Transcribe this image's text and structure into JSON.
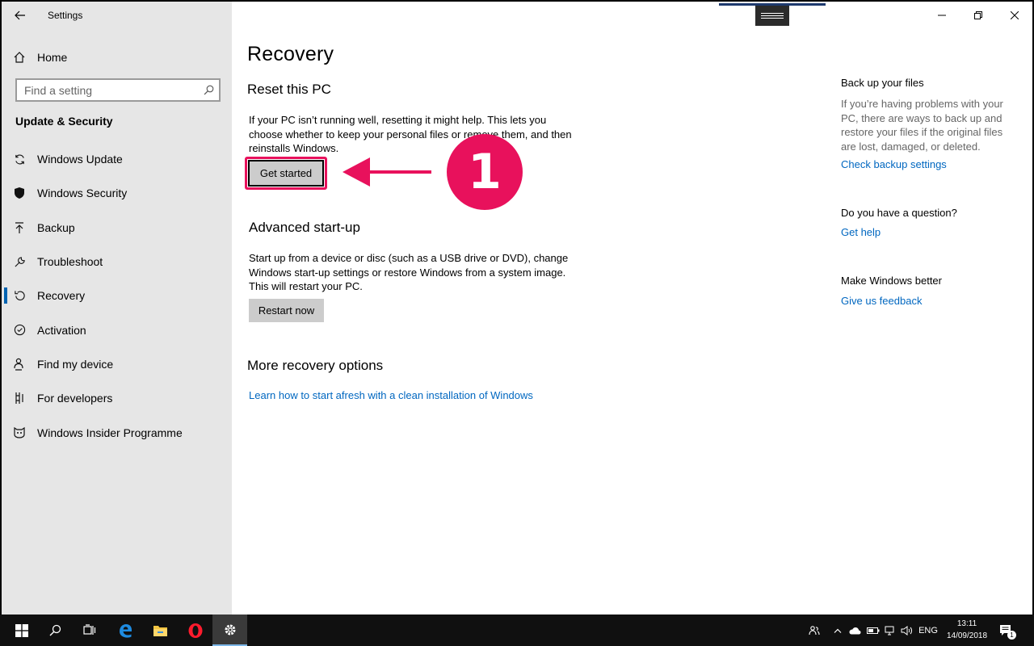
{
  "app": {
    "title": "Settings",
    "back_label": "←"
  },
  "sidebar": {
    "home_label": "Home",
    "search_placeholder": "Find a setting",
    "section_title": "Update & Security",
    "items": [
      {
        "label": "Windows Update",
        "icon": "sync-icon",
        "active": false
      },
      {
        "label": "Windows Security",
        "icon": "shield-icon",
        "active": false
      },
      {
        "label": "Backup",
        "icon": "backup-arrow-icon",
        "active": false
      },
      {
        "label": "Troubleshoot",
        "icon": "wrench-icon",
        "active": false
      },
      {
        "label": "Recovery",
        "icon": "recovery-icon",
        "active": true
      },
      {
        "label": "Activation",
        "icon": "check-circle-icon",
        "active": false
      },
      {
        "label": "Find my device",
        "icon": "person-location-icon",
        "active": false
      },
      {
        "label": "For developers",
        "icon": "developer-icon",
        "active": false
      },
      {
        "label": "Windows Insider Programme",
        "icon": "insider-icon",
        "active": false
      }
    ]
  },
  "main": {
    "page_title": "Recovery",
    "reset": {
      "heading": "Reset this PC",
      "description": "If your PC isn’t running well, resetting it might help. This lets you choose whether to keep your personal files or remove them, and then reinstalls Windows.",
      "button_label": "Get started"
    },
    "annotation": {
      "badge_number": "1",
      "accent": "#e8115c"
    },
    "advanced": {
      "heading": "Advanced start-up",
      "description": "Start up from a device or disc (such as a USB drive or DVD), change Windows start-up settings or restore Windows from a system image. This will restart your PC.",
      "button_label": "Restart now"
    },
    "more": {
      "heading": "More recovery options",
      "link_label": "Learn how to start afresh with a clean installation of Windows"
    }
  },
  "aside": {
    "backup_heading": "Back up your files",
    "backup_text": "If you’re having problems with your PC, there are ways to back up and restore your files if the original files are lost, damaged, or deleted.",
    "backup_link": "Check backup settings",
    "question_heading": "Do you have a question?",
    "question_link": "Get help",
    "better_heading": "Make Windows better",
    "better_link": "Give us feedback"
  },
  "taskbar": {
    "language": "ENG",
    "time": "13:11",
    "date": "14/09/2018",
    "notification_count": "1"
  },
  "colors": {
    "accent_link": "#0067c0",
    "sidebar_bg": "#e6e6e6",
    "active_indicator": "#0063b1"
  }
}
